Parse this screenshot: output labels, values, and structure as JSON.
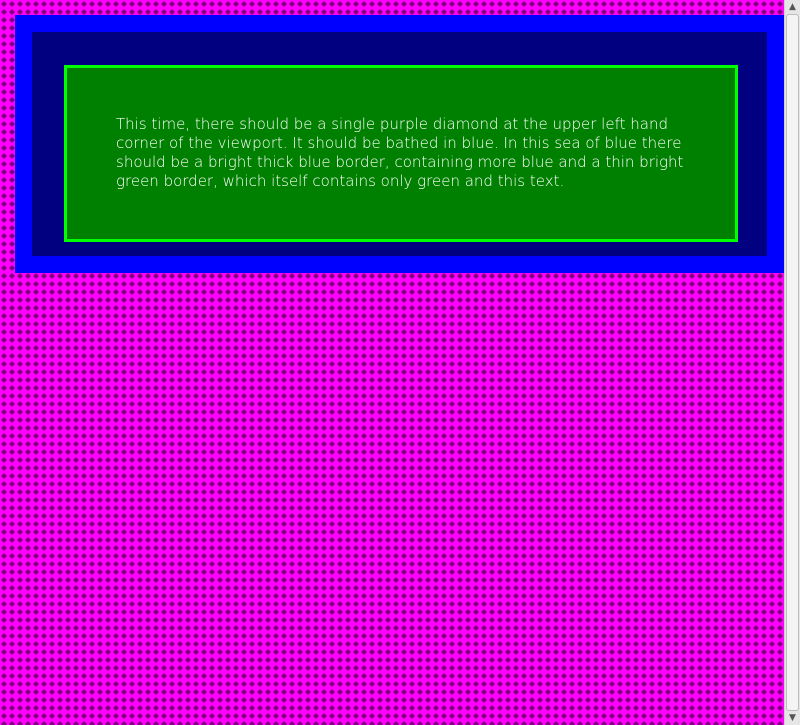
{
  "page": {
    "message": "This time, there should be a single purple diamond at the upper left hand corner of the viewport. It should be bathed in blue. In this sea of blue there should be a bright thick blue border, containing more blue and a thin bright green border, which itself contains only green and this text."
  },
  "colors": {
    "pattern_background": "#ff00ff",
    "pattern_diamond": "#800080",
    "outer_border": "#0000ff",
    "outer_fill": "#000080",
    "inner_border": "#00ff00",
    "inner_fill": "#008000",
    "text": "#ffffff"
  },
  "scrollbar": {
    "up_icon": "arrow-up-icon",
    "down_icon": "arrow-down-icon"
  }
}
